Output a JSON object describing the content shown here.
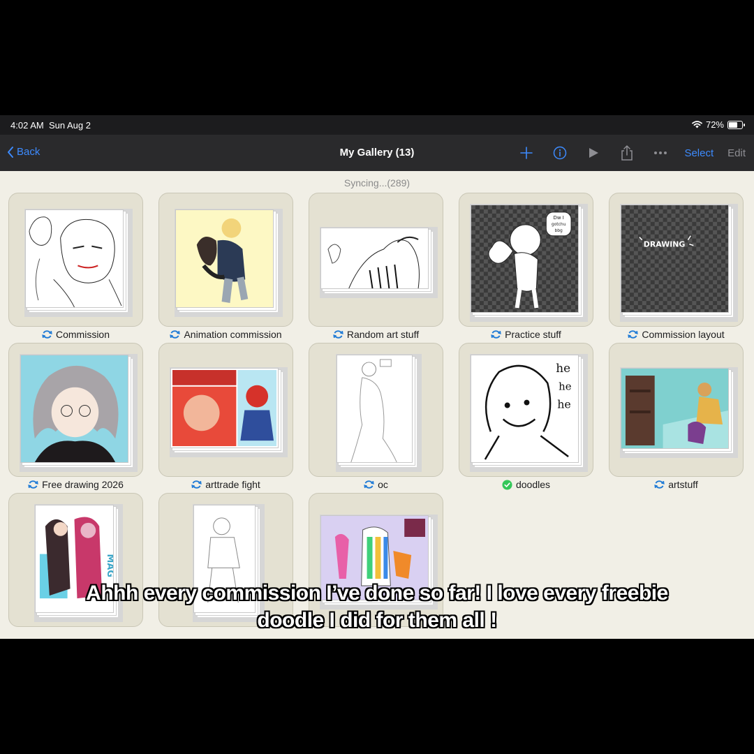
{
  "status": {
    "time": "4:02 AM",
    "date": "Sun Aug 2",
    "battery_text": "72%",
    "battery_level": 0.72
  },
  "nav": {
    "back_label": "Back",
    "title": "My Gallery (13)",
    "select_label": "Select",
    "edit_label": "Edit"
  },
  "sync_text": "Syncing...(289)",
  "gallery": [
    {
      "label": "Commission",
      "status": "syncing"
    },
    {
      "label": "Animation commission",
      "status": "syncing"
    },
    {
      "label": "Random art stuff",
      "status": "syncing"
    },
    {
      "label": "Practice stuff",
      "status": "syncing"
    },
    {
      "label": "Commission layout",
      "status": "syncing"
    },
    {
      "label": "Free drawing 2026",
      "status": "syncing"
    },
    {
      "label": "arttrade fight",
      "status": "syncing"
    },
    {
      "label": "oc",
      "status": "syncing"
    },
    {
      "label": "doodles",
      "status": "synced"
    },
    {
      "label": "artstuff",
      "status": "syncing"
    },
    {
      "label": "",
      "status": ""
    },
    {
      "label": "",
      "status": ""
    },
    {
      "label": "",
      "status": ""
    }
  ],
  "thumb_text": {
    "speech": [
      "Dw I",
      "gotchu",
      "bbg"
    ],
    "drawing_word": "DRAWING",
    "he": [
      "he",
      "he",
      "he"
    ],
    "mag": "MAG"
  },
  "caption": {
    "line1": "Ahhh every commission I’ve done so far! I love every freebie",
    "line2": "doodle I did for them all !"
  },
  "colors": {
    "accent": "#3d8bff",
    "sync_blue": "#1e7ad6",
    "synced_green": "#34c759",
    "nav_bg": "#2a2a2c",
    "screen_bg": "#f1efe6"
  }
}
